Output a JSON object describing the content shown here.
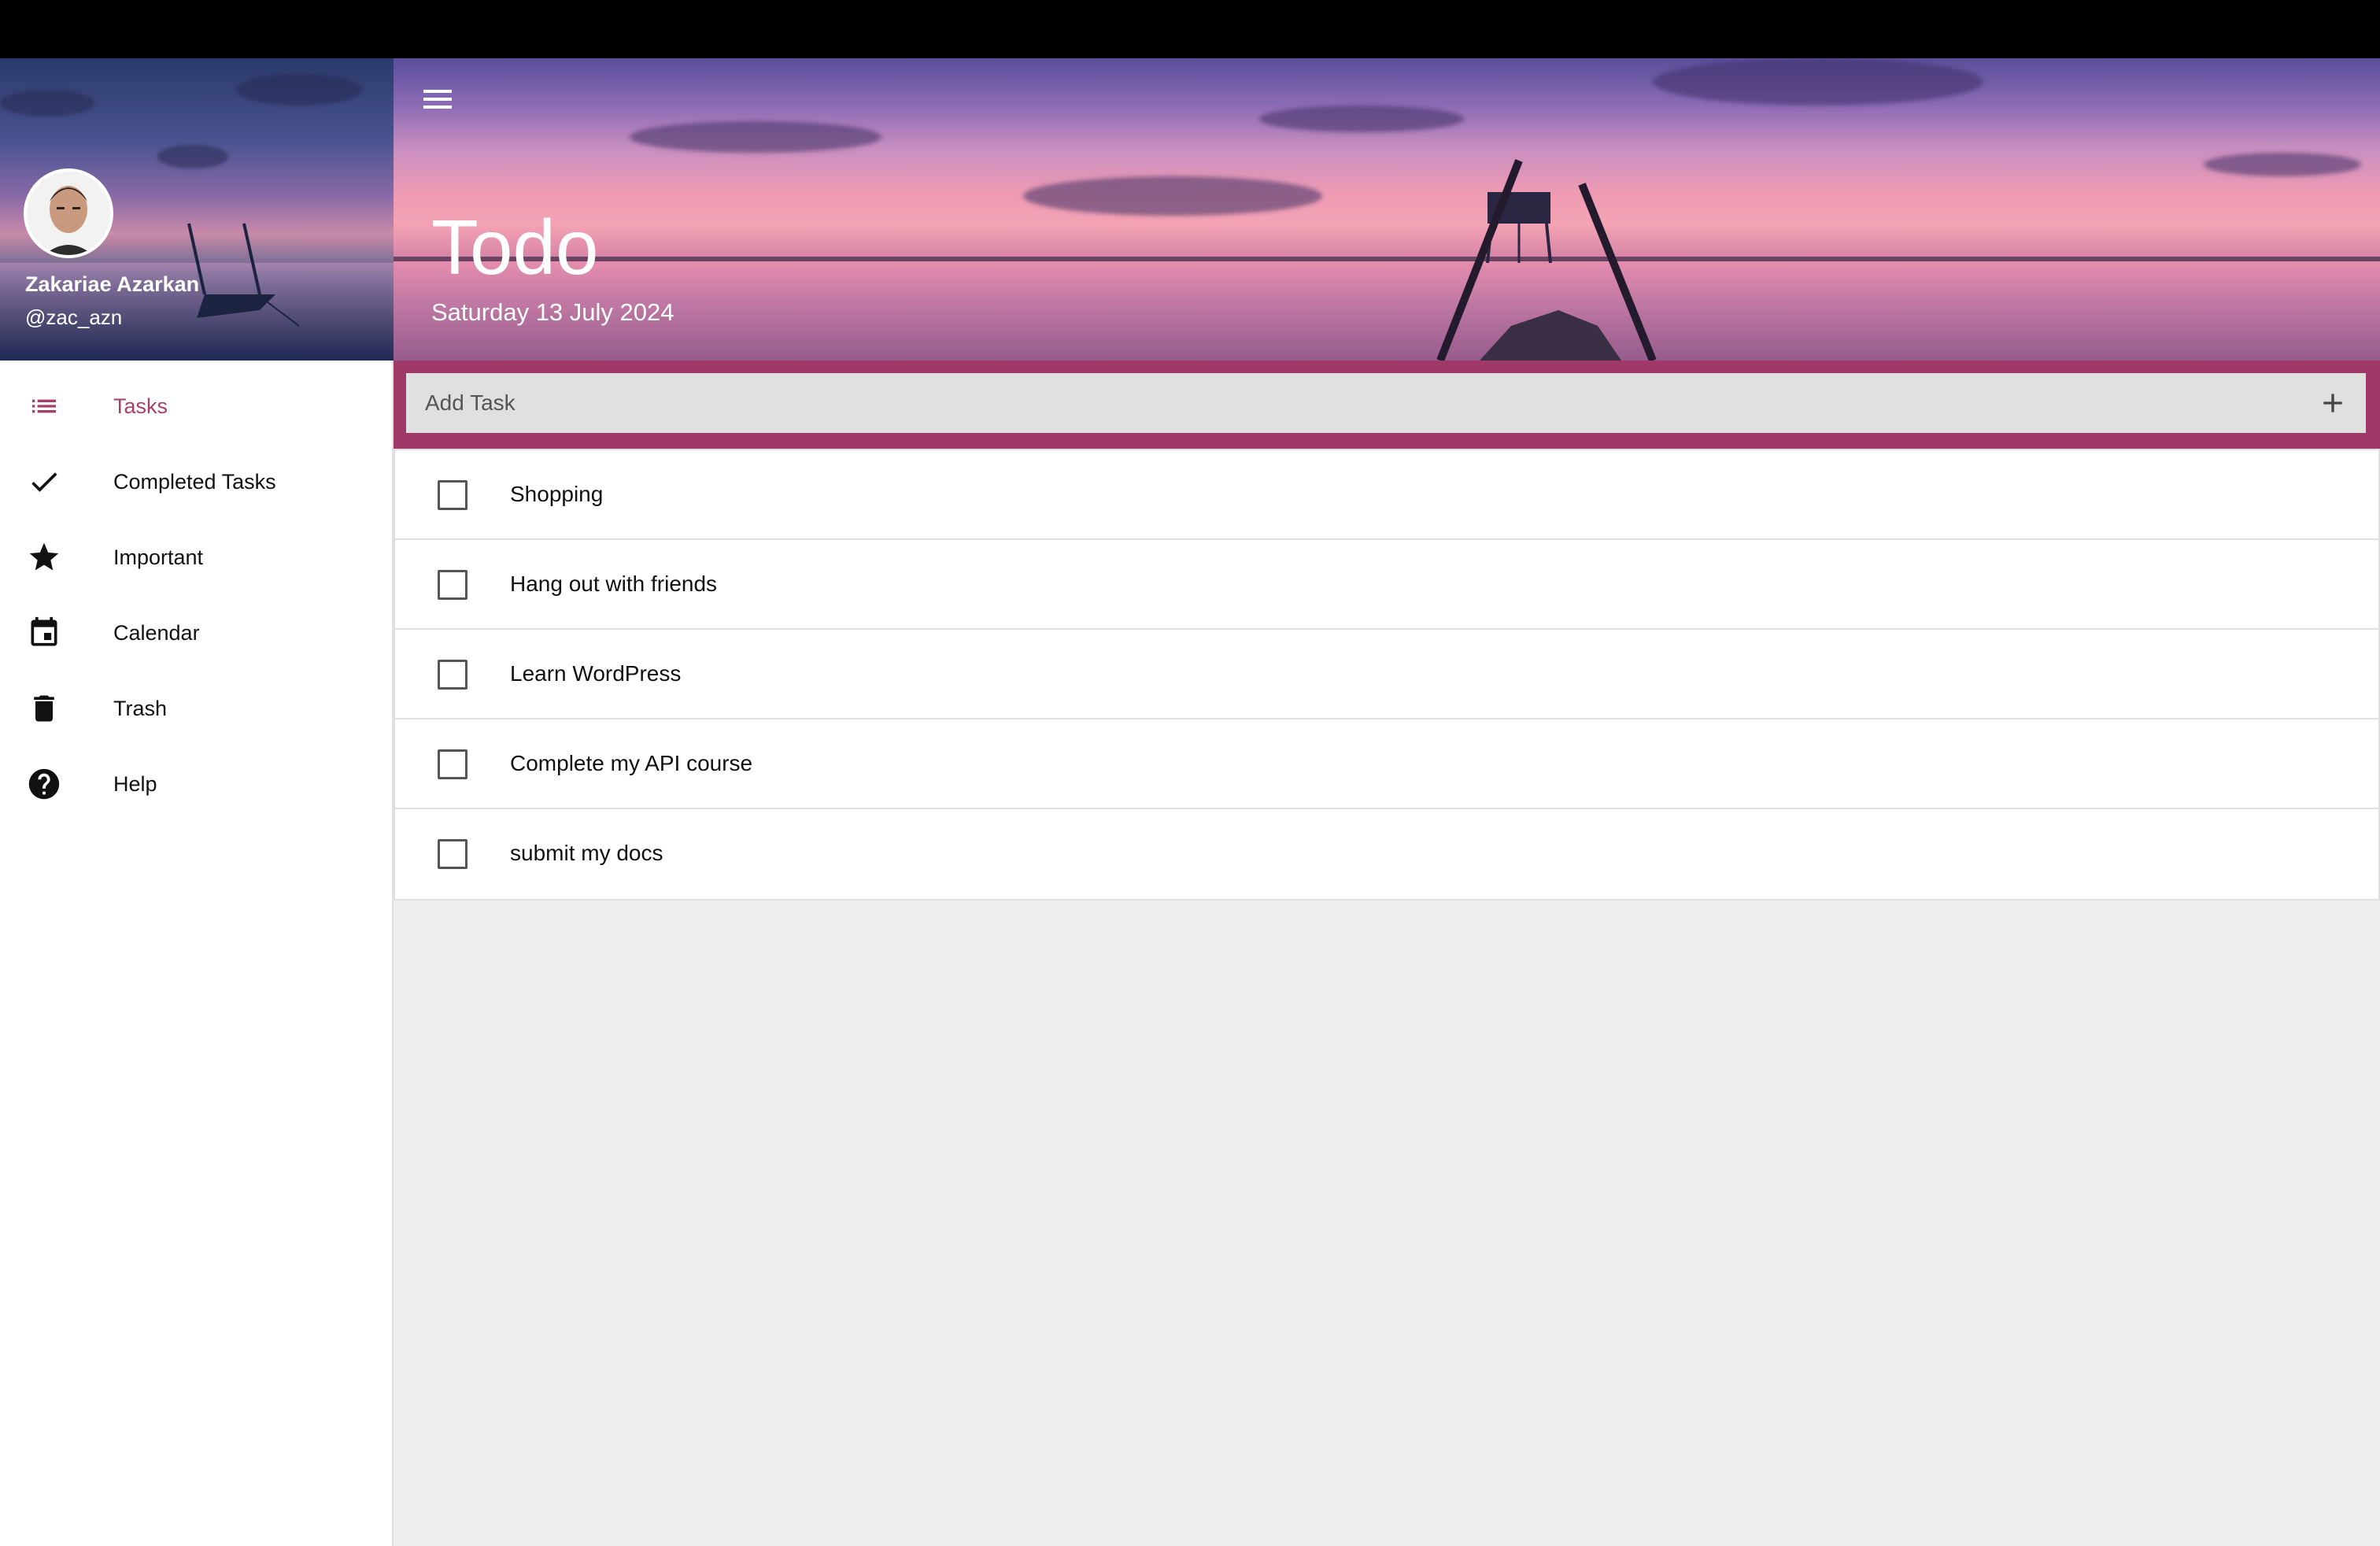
{
  "profile": {
    "name": "Zakariae Azarkan",
    "handle": "@zac_azn"
  },
  "nav": [
    {
      "label": "Tasks",
      "icon": "list-icon",
      "active": true
    },
    {
      "label": "Completed Tasks",
      "icon": "check-icon",
      "active": false
    },
    {
      "label": "Important",
      "icon": "star-icon",
      "active": false
    },
    {
      "label": "Calendar",
      "icon": "calendar-icon",
      "active": false
    },
    {
      "label": "Trash",
      "icon": "trash-icon",
      "active": false
    },
    {
      "label": "Help",
      "icon": "help-icon",
      "active": false
    }
  ],
  "header": {
    "title": "Todo",
    "date": "Saturday 13 July 2024"
  },
  "add_task": {
    "placeholder": "Add Task"
  },
  "tasks": [
    {
      "label": "Shopping",
      "done": false
    },
    {
      "label": "Hang out with friends",
      "done": false
    },
    {
      "label": "Learn WordPress",
      "done": false
    },
    {
      "label": "Complete my API course",
      "done": false
    },
    {
      "label": "submit my docs",
      "done": false
    }
  ],
  "colors": {
    "accent": "#9f3a68",
    "active_nav": "#a63e70",
    "content_bg": "#eeeeee"
  }
}
